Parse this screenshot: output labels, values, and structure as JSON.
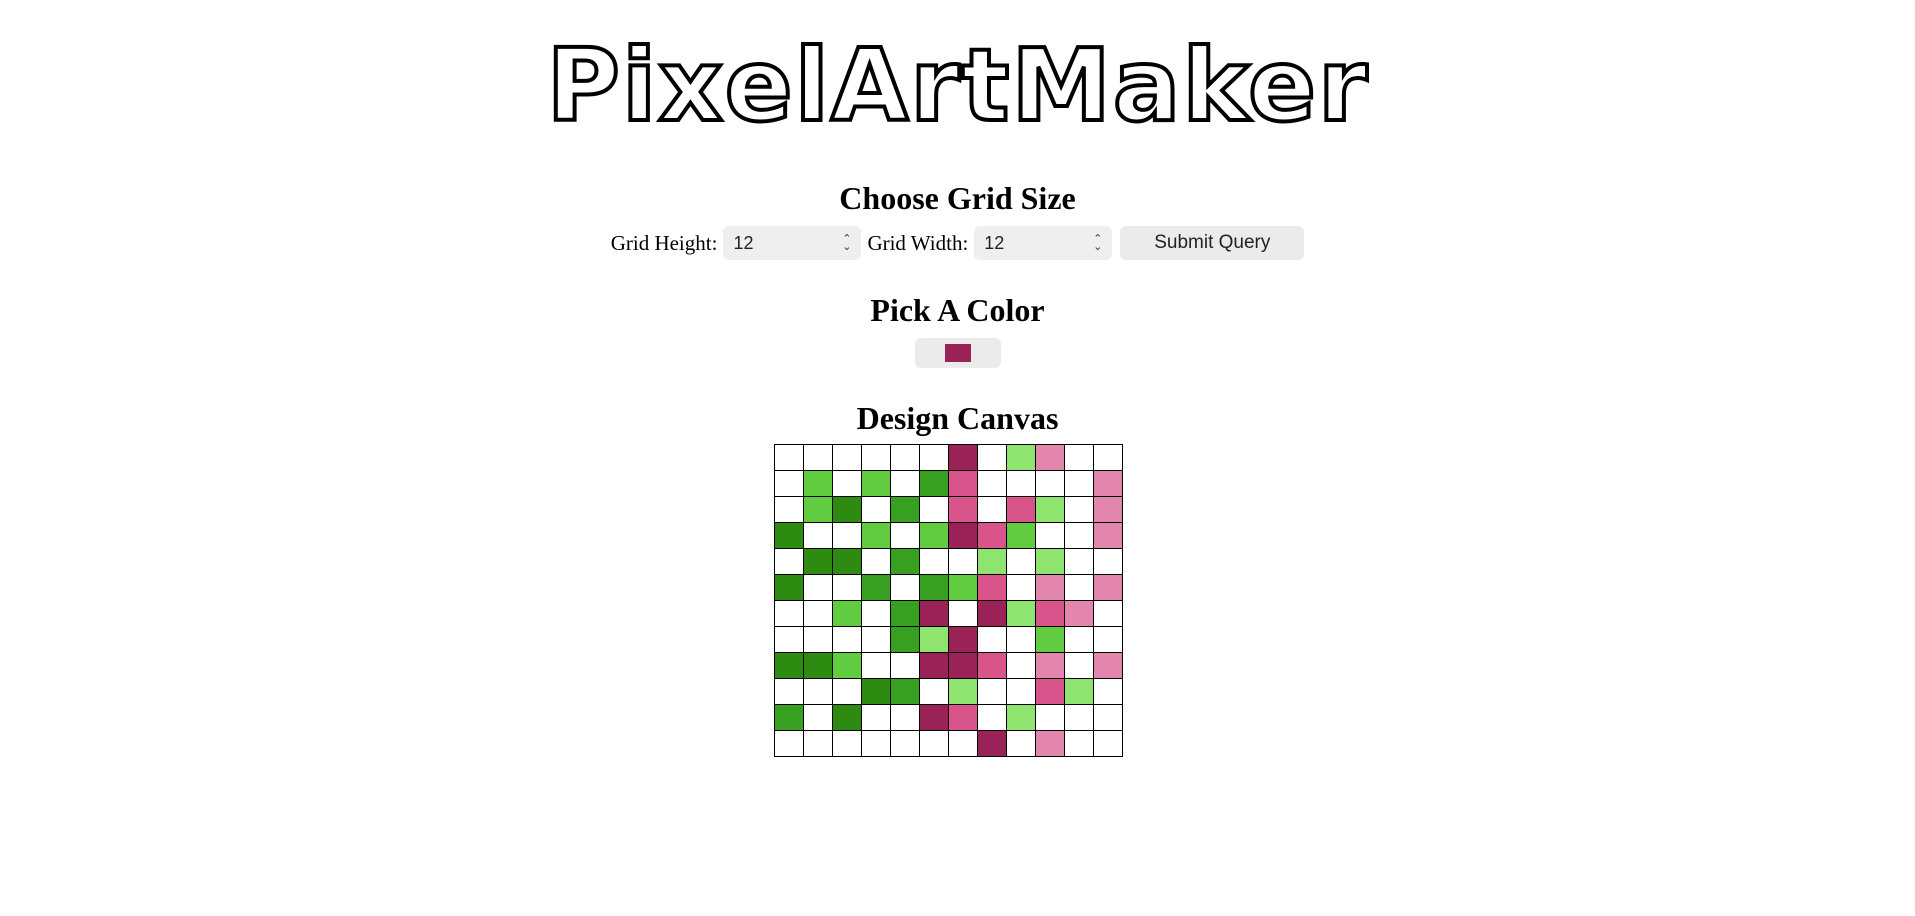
{
  "logo": {
    "text": "PixelArtMaker"
  },
  "grid_size": {
    "heading": "Choose Grid Size",
    "height_label": "Grid Height:",
    "height_value": "12",
    "width_label": "Grid Width:",
    "width_value": "12",
    "submit_label": "Submit Query"
  },
  "color": {
    "heading": "Pick A Color",
    "selected": "#9a2257"
  },
  "canvas": {
    "heading": "Design Canvas",
    "palette": {
      "w": "#ffffff",
      "D": "#2e8b12",
      "M": "#38a020",
      "L": "#62cc40",
      "l": "#8ee46f",
      "R": "#9a2257",
      "P": "#d9548a",
      "p": "#e286ad"
    },
    "rows": [
      "wwwwwwRwlpww",
      "wLwLwMPwwwwp",
      "wLDwMwPwPlwp",
      "DwwLwLRPLwwp",
      "wDDwMwwlwlww",
      "DwwMwMLPwpwp",
      "wwLwMRwRlPpw",
      "wwwwMlRwwLww",
      "DDLwwRRPwpwp",
      "wwwDMwlwwPlw",
      "MwDwwRPwlwww",
      "wwwwwwwRwpww"
    ]
  }
}
